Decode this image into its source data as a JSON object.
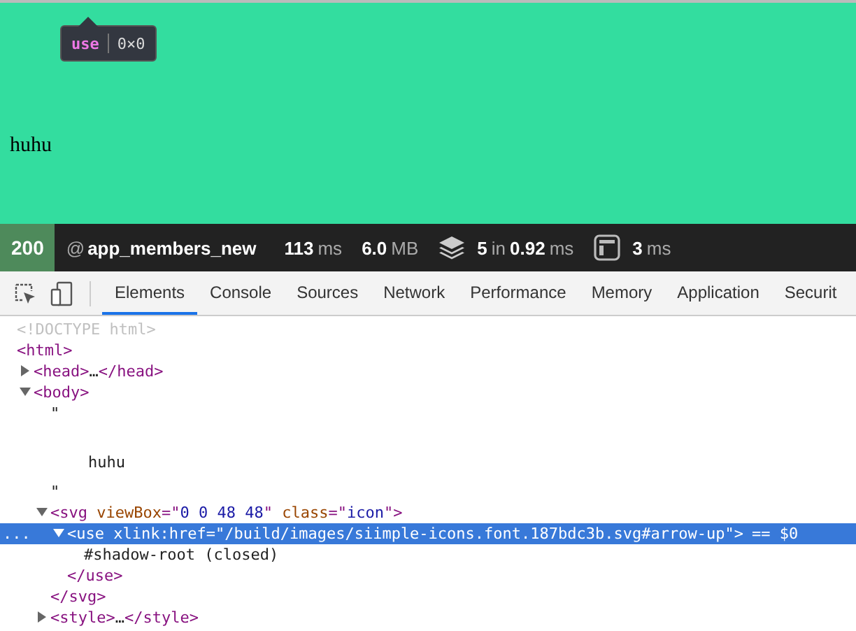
{
  "tooltip": {
    "tag": "use",
    "size": "0×0"
  },
  "page": {
    "text": "huhu"
  },
  "status_bar": {
    "code": "200",
    "at": "@",
    "route": "app_members_new",
    "metrics": [
      {
        "kind": "plain",
        "segments": [
          {
            "kind": "value",
            "text": "113"
          },
          {
            "kind": "unit",
            "text": "ms"
          }
        ]
      },
      {
        "kind": "plain",
        "segments": [
          {
            "kind": "value",
            "text": "6.0"
          },
          {
            "kind": "unit",
            "text": "MB"
          }
        ]
      },
      {
        "kind": "layers",
        "segments": [
          {
            "kind": "value",
            "text": "5"
          },
          {
            "kind": "unit",
            "text": "in"
          },
          {
            "kind": "value",
            "text": "0.92"
          },
          {
            "kind": "unit",
            "text": "ms"
          }
        ]
      },
      {
        "kind": "template",
        "segments": [
          {
            "kind": "value",
            "text": "3"
          },
          {
            "kind": "unit",
            "text": "ms"
          }
        ]
      }
    ]
  },
  "devtools_tabs": [
    {
      "label": "Elements",
      "selected": true
    },
    {
      "label": "Console",
      "selected": false
    },
    {
      "label": "Sources",
      "selected": false
    },
    {
      "label": "Network",
      "selected": false
    },
    {
      "label": "Performance",
      "selected": false
    },
    {
      "label": "Memory",
      "selected": false
    },
    {
      "label": "Application",
      "selected": false
    },
    {
      "label": "Securit",
      "selected": false
    }
  ],
  "dom": [
    {
      "selected": false,
      "tokens": [
        {
          "kind": "doctype",
          "text": "<!DOCTYPE html>"
        }
      ]
    },
    {
      "selected": false,
      "tokens": [
        {
          "kind": "tag",
          "text": "<html>"
        }
      ],
      "children": [
        {
          "expanded": false,
          "selected": false,
          "tokens": [
            {
              "kind": "tag",
              "text": "<head>"
            },
            {
              "kind": "text",
              "text": "…"
            },
            {
              "kind": "tag",
              "text": "</head>"
            }
          ]
        },
        {
          "expanded": true,
          "selected": false,
          "tokens": [
            {
              "kind": "tag",
              "text": "<body>"
            }
          ],
          "children": [
            {
              "selected": false,
              "kind": "text-node",
              "tokens": [
                {
                  "kind": "text",
                  "text": "\""
                }
              ],
              "children": [
                {
                  "selected": false,
                  "tokens": [
                    {
                      "kind": "text",
                      "text": "huhu"
                    }
                  ]
                }
              ]
            },
            {
              "selected": false,
              "tokens": [
                {
                  "kind": "text",
                  "text": "\""
                }
              ]
            },
            {
              "expanded": true,
              "selected": false,
              "tokens": [
                {
                  "kind": "tag",
                  "text": "<svg"
                },
                {
                  "kind": "attr-name",
                  "text": " viewBox"
                },
                {
                  "kind": "tag",
                  "text": "=\""
                },
                {
                  "kind": "attr-value",
                  "text": "0 0 48 48"
                },
                {
                  "kind": "tag",
                  "text": "\""
                },
                {
                  "kind": "attr-name",
                  "text": " class"
                },
                {
                  "kind": "tag",
                  "text": "=\""
                },
                {
                  "kind": "attr-value",
                  "text": "icon"
                },
                {
                  "kind": "tag",
                  "text": "\">"
                }
              ],
              "children": [
                {
                  "expanded": true,
                  "selected": true,
                  "dots": "...",
                  "suffix": "== $0",
                  "tokens": [
                    {
                      "kind": "tag",
                      "text": "<use"
                    },
                    {
                      "kind": "attr-name",
                      "text": " xlink:href"
                    },
                    {
                      "kind": "tag",
                      "text": "=\""
                    },
                    {
                      "kind": "attr-value",
                      "text": "/build/images/siimple-icons.font.187bdc3b.svg#arrow-up"
                    },
                    {
                      "kind": "tag",
                      "text": "\">"
                    }
                  ],
                  "children": [
                    {
                      "selected": false,
                      "tokens": [
                        {
                          "kind": "text",
                          "text": "#shadow-root (closed)"
                        }
                      ]
                    }
                  ]
                },
                {
                  "selected": false,
                  "tokens": [
                    {
                      "kind": "tag",
                      "text": "</use>"
                    }
                  ]
                }
              ]
            },
            {
              "selected": false,
              "tokens": [
                {
                  "kind": "tag",
                  "text": "</svg>"
                }
              ]
            },
            {
              "expanded": false,
              "selected": false,
              "tokens": [
                {
                  "kind": "tag",
                  "text": "<style>"
                },
                {
                  "kind": "text",
                  "text": "…"
                },
                {
                  "kind": "tag",
                  "text": "</style>"
                }
              ]
            }
          ]
        }
      ]
    }
  ]
}
